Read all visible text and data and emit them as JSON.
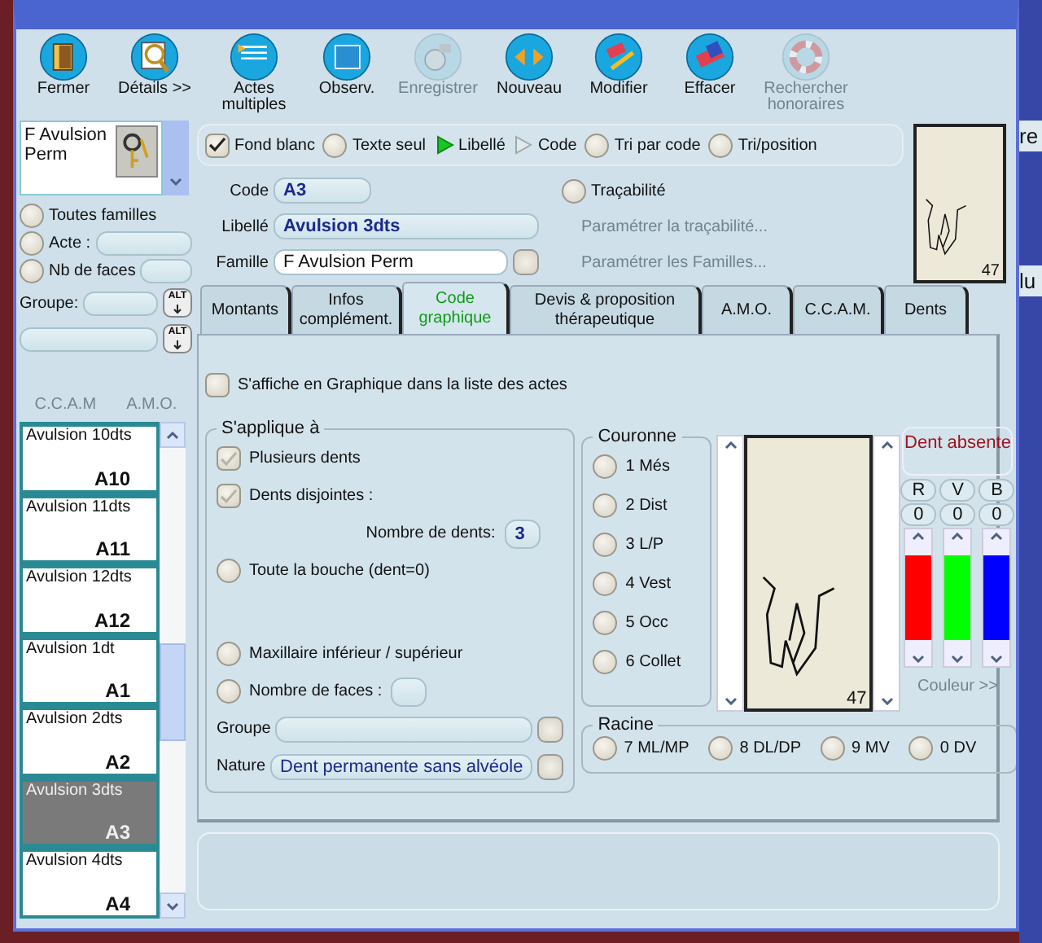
{
  "toolbar": [
    {
      "label": "Fermer",
      "disabled": false
    },
    {
      "label": "Détails >>",
      "disabled": false
    },
    {
      "label": "Actes multiples",
      "disabled": false
    },
    {
      "label": "Observ.",
      "disabled": false
    },
    {
      "label": "Enregistrer",
      "disabled": true
    },
    {
      "label": "Nouveau",
      "disabled": false
    },
    {
      "label": "Modifier",
      "disabled": false
    },
    {
      "label": "Effacer",
      "disabled": false
    },
    {
      "label": "Rechercher honoraires",
      "disabled": true
    }
  ],
  "family_selector": {
    "value": "F Avulsion Perm"
  },
  "filters": [
    {
      "label": "Toutes familles",
      "selected": false
    },
    {
      "label": "Acte :",
      "selected": false
    },
    {
      "label": "Nb de faces",
      "selected": false
    }
  ],
  "group_filter": {
    "label": "Groupe:",
    "button": "ALT"
  },
  "second_filter": {
    "button": "ALT"
  },
  "list_headers": [
    "C.C.A.M",
    "A.M.O."
  ],
  "acts": [
    {
      "name": "Avulsion 10dts",
      "code": "A10",
      "selected": false
    },
    {
      "name": "Avulsion 11dts",
      "code": "A11",
      "selected": false
    },
    {
      "name": "Avulsion 12dts",
      "code": "A12",
      "selected": false
    },
    {
      "name": "Avulsion 1dt",
      "code": "A1",
      "selected": false
    },
    {
      "name": "Avulsion 2dts",
      "code": "A2",
      "selected": false
    },
    {
      "name": "Avulsion 3dts",
      "code": "A3",
      "selected": true
    },
    {
      "name": "Avulsion 4dts",
      "code": "A4",
      "selected": false
    }
  ],
  "display_options": [
    {
      "kind": "checkbox",
      "label": "Fond blanc",
      "selected": true
    },
    {
      "kind": "radio",
      "label": "Texte seul",
      "selected": false
    },
    {
      "kind": "play",
      "label": "Libellé",
      "selected": true
    },
    {
      "kind": "play",
      "label": "Code",
      "selected": false
    },
    {
      "kind": "radio",
      "label": "Tri par code",
      "selected": false
    },
    {
      "kind": "radio",
      "label": "Tri/position",
      "selected": false
    }
  ],
  "fields": {
    "code": {
      "label": "Code",
      "value": "A3"
    },
    "libelle": {
      "label": "Libellé",
      "value": "Avulsion 3dts"
    },
    "famille": {
      "label": "Famille",
      "value": "F Avulsion Perm"
    }
  },
  "tracabilite": {
    "label": "Traçabilité",
    "selected": false
  },
  "links": [
    {
      "label": "Paramétrer la traçabilité...",
      "disabled": true
    },
    {
      "label": "Paramétrer les Familles...",
      "disabled": true
    }
  ],
  "thumbnail": {
    "number": "47"
  },
  "tabs": [
    {
      "label": "Montants",
      "selected": false
    },
    {
      "label": "Infos complément.",
      "selected": false
    },
    {
      "label": "Code graphique",
      "selected": true
    },
    {
      "label": "Devis & proposition thérapeutique",
      "selected": false
    },
    {
      "label": "A.M.O.",
      "selected": false
    },
    {
      "label": "C.C.A.M.",
      "selected": false
    },
    {
      "label": "Dents",
      "selected": false
    }
  ],
  "graphic_option": {
    "label": "S'affiche en Graphique dans la liste des actes",
    "checked": false
  },
  "applies_to": {
    "title": "S'applique à",
    "plusieurs": {
      "label": "Plusieurs dents",
      "checked": true
    },
    "disjointes": {
      "label": "Dents disjointes :",
      "checked": true
    },
    "nombre_dents": {
      "label": "Nombre de dents:",
      "value": "3"
    },
    "bouche": {
      "label": "Toute la bouche (dent=0)",
      "checked": false
    },
    "maxillaire": {
      "label": "Maxillaire inférieur / supérieur",
      "checked": false
    },
    "faces": {
      "label": "Nombre de faces :",
      "checked": false
    },
    "groupe": {
      "label": "Groupe"
    },
    "nature": {
      "label": "Nature",
      "value": "Dent permanente sans alvéole"
    }
  },
  "couronne": {
    "title": "Couronne",
    "options": [
      {
        "label": "1 Més",
        "selected": false
      },
      {
        "label": "2 Dist",
        "selected": false
      },
      {
        "label": "3 L/P",
        "selected": false
      },
      {
        "label": "4 Vest",
        "selected": false
      },
      {
        "label": "5 Occ",
        "selected": false
      },
      {
        "label": "6 Collet",
        "selected": false
      }
    ]
  },
  "tooth_view": {
    "number": "47"
  },
  "absent_label": "Dent absente",
  "color_channels": [
    {
      "label": "R",
      "value": "0",
      "color": "#ff0000"
    },
    {
      "label": "V",
      "value": "0",
      "color": "#00ff00"
    },
    {
      "label": "B",
      "value": "0",
      "color": "#0000ff"
    }
  ],
  "color_link": "Couleur >>",
  "racine": {
    "title": "Racine",
    "options": [
      {
        "label": "7 ML/MP",
        "selected": false
      },
      {
        "label": "8 DL/DP",
        "selected": false
      },
      {
        "label": "9 MV",
        "selected": false
      },
      {
        "label": "0 DV",
        "selected": false
      }
    ]
  },
  "background_fragments": [
    "re",
    "lu"
  ]
}
